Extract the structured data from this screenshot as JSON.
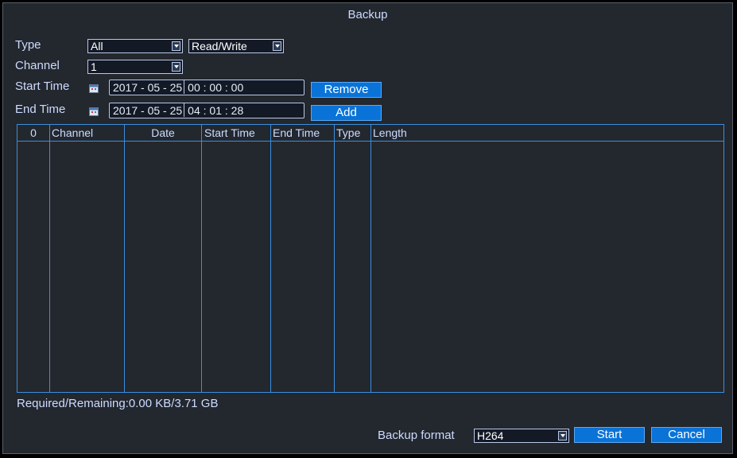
{
  "dialog": {
    "title": "Backup"
  },
  "type": {
    "label": "Type",
    "value": "All",
    "mode": "Read/Write"
  },
  "channel": {
    "label": "Channel",
    "value": "1"
  },
  "start_time": {
    "label": "Start Time",
    "date": "2017 - 05 - 25",
    "time": "00 : 00 : 00"
  },
  "end_time": {
    "label": "End Time",
    "date": "2017 - 05 - 25",
    "time": "04 : 01 : 28"
  },
  "buttons": {
    "remove": "Remove",
    "add": "Add",
    "start": "Start",
    "cancel": "Cancel"
  },
  "table": {
    "headers": [
      "0",
      "Channel",
      "Date",
      "Start Time",
      "End Time",
      "Type",
      "Length"
    ],
    "rows": []
  },
  "status": {
    "text": "Required/Remaining:0.00 KB/3.71 GB"
  },
  "backup_format": {
    "label": "Backup format",
    "value": "H264"
  },
  "colors": {
    "panel": "#23272e",
    "accent_button": "#0a73d8",
    "grid_line": "#3a8fe0",
    "text": "#ccdcff"
  }
}
